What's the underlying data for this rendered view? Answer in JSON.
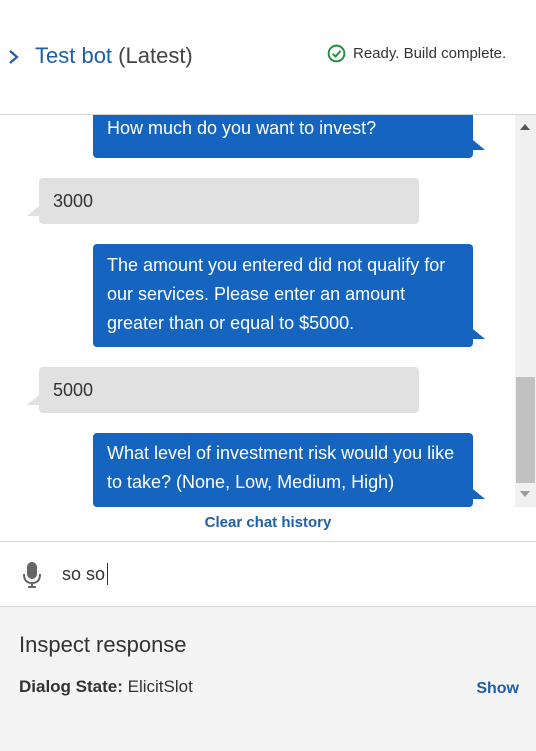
{
  "header": {
    "title_name": "Test bot",
    "title_version": "(Latest)",
    "status_text": "Ready. Build complete.",
    "status_icon": "check-circle-icon",
    "status_color": "#1e8e3e"
  },
  "chat": {
    "messages": [
      {
        "from": "bot",
        "text": "How much do you want to invest?"
      },
      {
        "from": "user",
        "text": "3000"
      },
      {
        "from": "bot",
        "text": "The amount you entered did not qualify for our services. Please enter an amount greater than or equal to $5000."
      },
      {
        "from": "user",
        "text": "5000"
      },
      {
        "from": "bot",
        "text": "What level of investment risk would you like to take? (None, Low, Medium, High)"
      }
    ],
    "clear_label": "Clear chat history"
  },
  "input": {
    "value": "so so",
    "mic_icon": "microphone-icon"
  },
  "inspect": {
    "title": "Inspect response",
    "dialog_state_label": "Dialog State:",
    "dialog_state_value": "ElicitSlot",
    "show_label": "Show"
  },
  "colors": {
    "accent": "#1f5ea8",
    "bot_bubble": "#1565c0",
    "user_bubble": "#e1e1e1"
  }
}
